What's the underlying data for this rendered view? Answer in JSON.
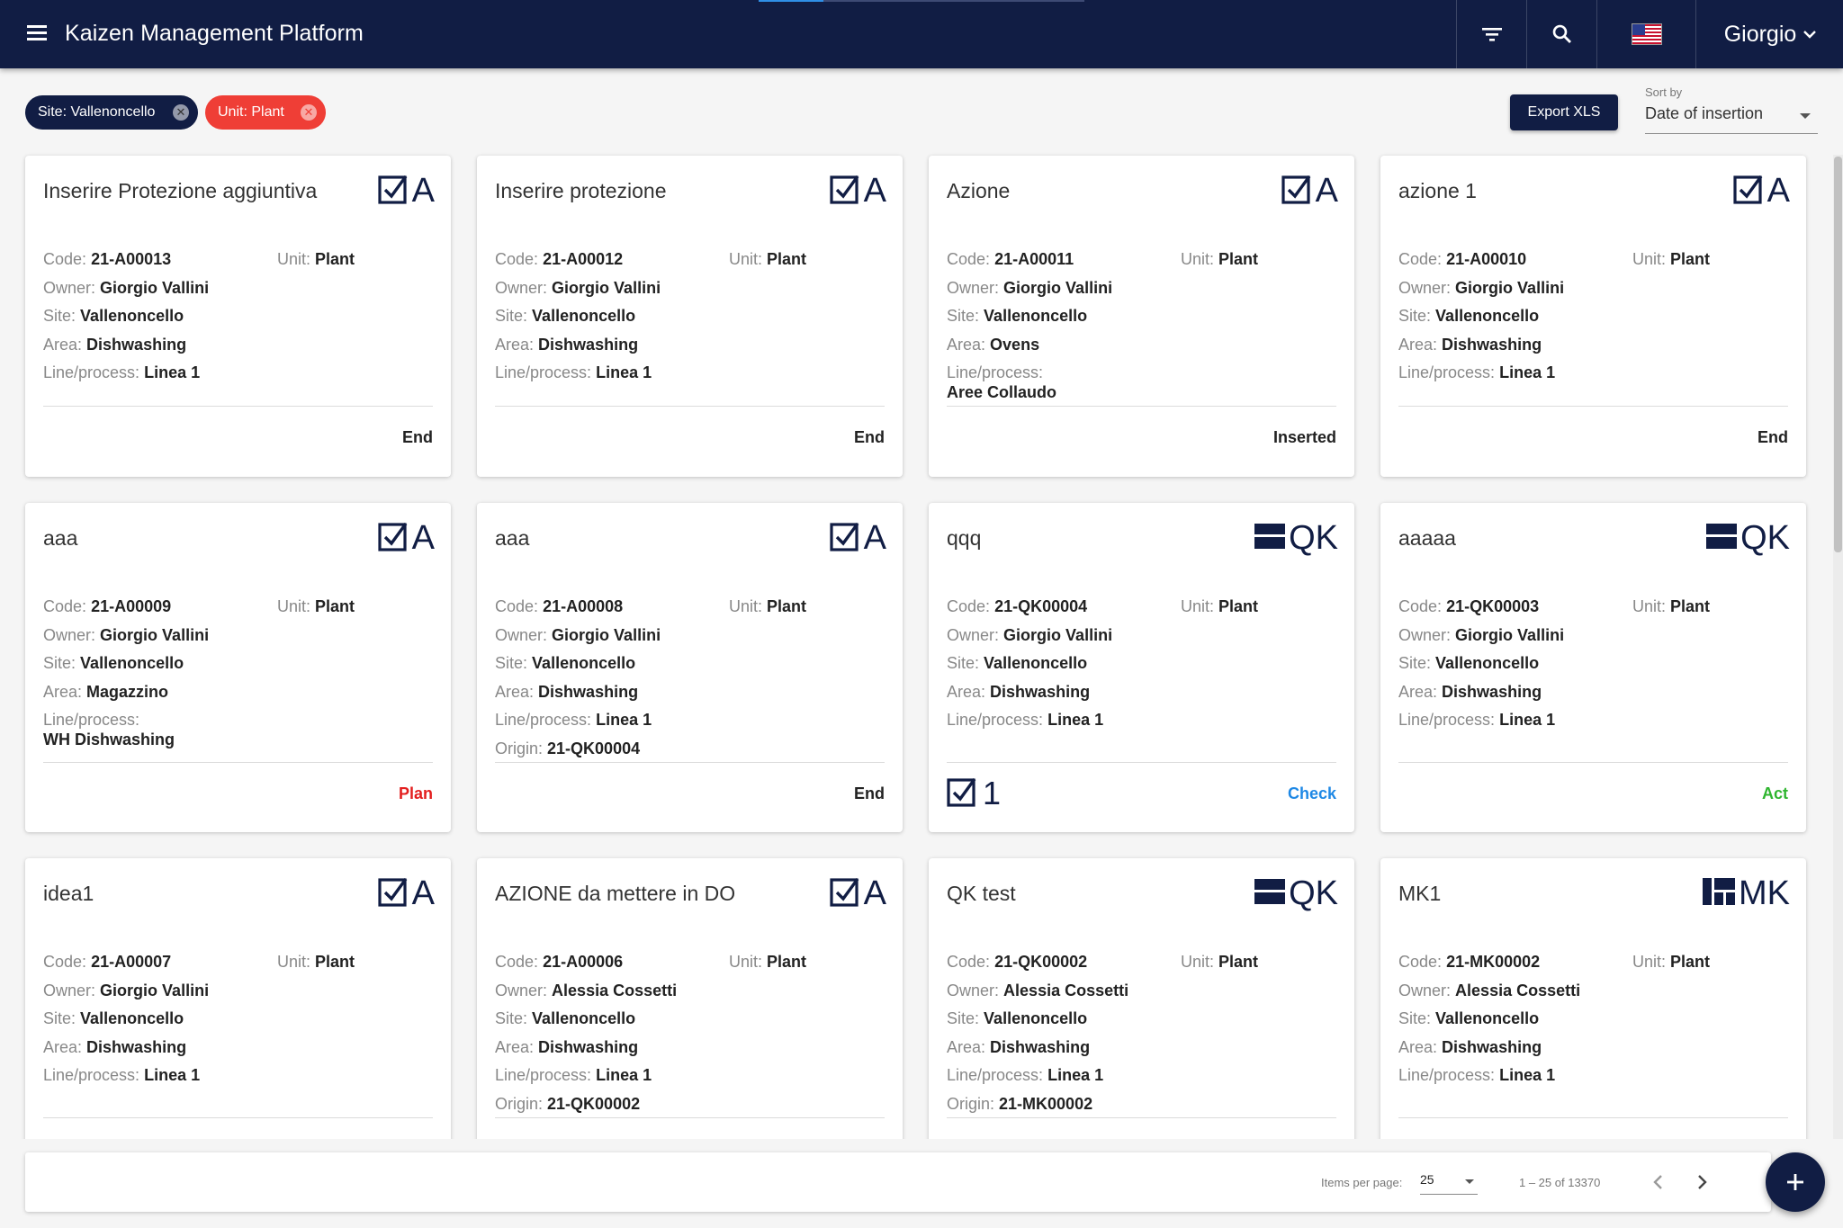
{
  "app": {
    "title": "Kaizen Management Platform",
    "user_name": "Giorgio"
  },
  "filters": [
    {
      "label": "Site: Vallenoncello",
      "color": "#111d44"
    },
    {
      "label": "Unit: Plant",
      "color": "#ef3e36"
    }
  ],
  "toolbar": {
    "export_label": "Export XLS",
    "sort_label": "Sort by",
    "sort_value": "Date of insertion"
  },
  "labels": {
    "code": "Code:",
    "owner": "Owner:",
    "site": "Site:",
    "area": "Area:",
    "line": "Line/process:",
    "origin": "Origin:",
    "unit": "Unit:"
  },
  "colors": {
    "navy": "#111d44",
    "plan": "#e31e1e",
    "check": "#1e88e5",
    "act": "#2fb52f"
  },
  "cards": [
    {
      "title": "Inserire Protezione aggiuntiva",
      "type": "A",
      "icon": "checkbox-icon",
      "code": "21-A00013",
      "unit": "Plant",
      "owner": "Giorgio Vallini",
      "site": "Vallenoncello",
      "area": "Dishwashing",
      "line": "Linea 1",
      "status": "End"
    },
    {
      "title": "Inserire protezione",
      "type": "A",
      "icon": "checkbox-icon",
      "code": "21-A00012",
      "unit": "Plant",
      "owner": "Giorgio Vallini",
      "site": "Vallenoncello",
      "area": "Dishwashing",
      "line": "Linea 1",
      "status": "End"
    },
    {
      "title": "Azione",
      "type": "A",
      "icon": "checkbox-icon",
      "code": "21-A00011",
      "unit": "Plant",
      "owner": "Giorgio Vallini",
      "site": "Vallenoncello",
      "area": "Ovens",
      "line": "Aree Collaudo",
      "status": "Inserted"
    },
    {
      "title": "azione 1",
      "type": "A",
      "icon": "checkbox-icon",
      "code": "21-A00010",
      "unit": "Plant",
      "owner": "Giorgio Vallini",
      "site": "Vallenoncello",
      "area": "Dishwashing",
      "line": "Linea 1",
      "status": "End"
    },
    {
      "title": "aaa",
      "type": "A",
      "icon": "checkbox-icon",
      "code": "21-A00009",
      "unit": "Plant",
      "owner": "Giorgio Vallini",
      "site": "Vallenoncello",
      "area": "Magazzino",
      "line": "WH Dishwashing",
      "status": "Plan"
    },
    {
      "title": "aaa",
      "type": "A",
      "icon": "checkbox-icon",
      "code": "21-A00008",
      "unit": "Plant",
      "owner": "Giorgio Vallini",
      "site": "Vallenoncello",
      "area": "Dishwashing",
      "line": "Linea 1",
      "origin": "21-QK00004",
      "status": "End"
    },
    {
      "title": "qqq",
      "type": "QK",
      "icon": "qk-icon",
      "code": "21-QK00004",
      "unit": "Plant",
      "owner": "Giorgio Vallini",
      "site": "Vallenoncello",
      "area": "Dishwashing",
      "line": "Linea 1",
      "status": "Check",
      "action_count": "1"
    },
    {
      "title": "aaaaa",
      "type": "QK",
      "icon": "qk-icon",
      "code": "21-QK00003",
      "unit": "Plant",
      "owner": "Giorgio Vallini",
      "site": "Vallenoncello",
      "area": "Dishwashing",
      "line": "Linea 1",
      "status": "Act"
    },
    {
      "title": "idea1",
      "type": "A",
      "icon": "checkbox-icon",
      "code": "21-A00007",
      "unit": "Plant",
      "owner": "Giorgio Vallini",
      "site": "Vallenoncello",
      "area": "Dishwashing",
      "line": "Linea 1"
    },
    {
      "title": "AZIONE da mettere in DO",
      "type": "A",
      "icon": "checkbox-icon",
      "code": "21-A00006",
      "unit": "Plant",
      "owner": "Alessia Cossetti",
      "site": "Vallenoncello",
      "area": "Dishwashing",
      "line": "Linea 1",
      "origin": "21-QK00002"
    },
    {
      "title": "QK test",
      "type": "QK",
      "icon": "qk-icon",
      "code": "21-QK00002",
      "unit": "Plant",
      "owner": "Alessia Cossetti",
      "site": "Vallenoncello",
      "area": "Dishwashing",
      "line": "Linea 1",
      "origin": "21-MK00002"
    },
    {
      "title": "MK1",
      "type": "MK",
      "icon": "mk-icon",
      "code": "21-MK00002",
      "unit": "Plant",
      "owner": "Alessia Cossetti",
      "site": "Vallenoncello",
      "area": "Dishwashing",
      "line": "Linea 1"
    }
  ],
  "paginator": {
    "items_label": "Items per page:",
    "page_size": "25",
    "range": "1 – 25 of 13370"
  }
}
